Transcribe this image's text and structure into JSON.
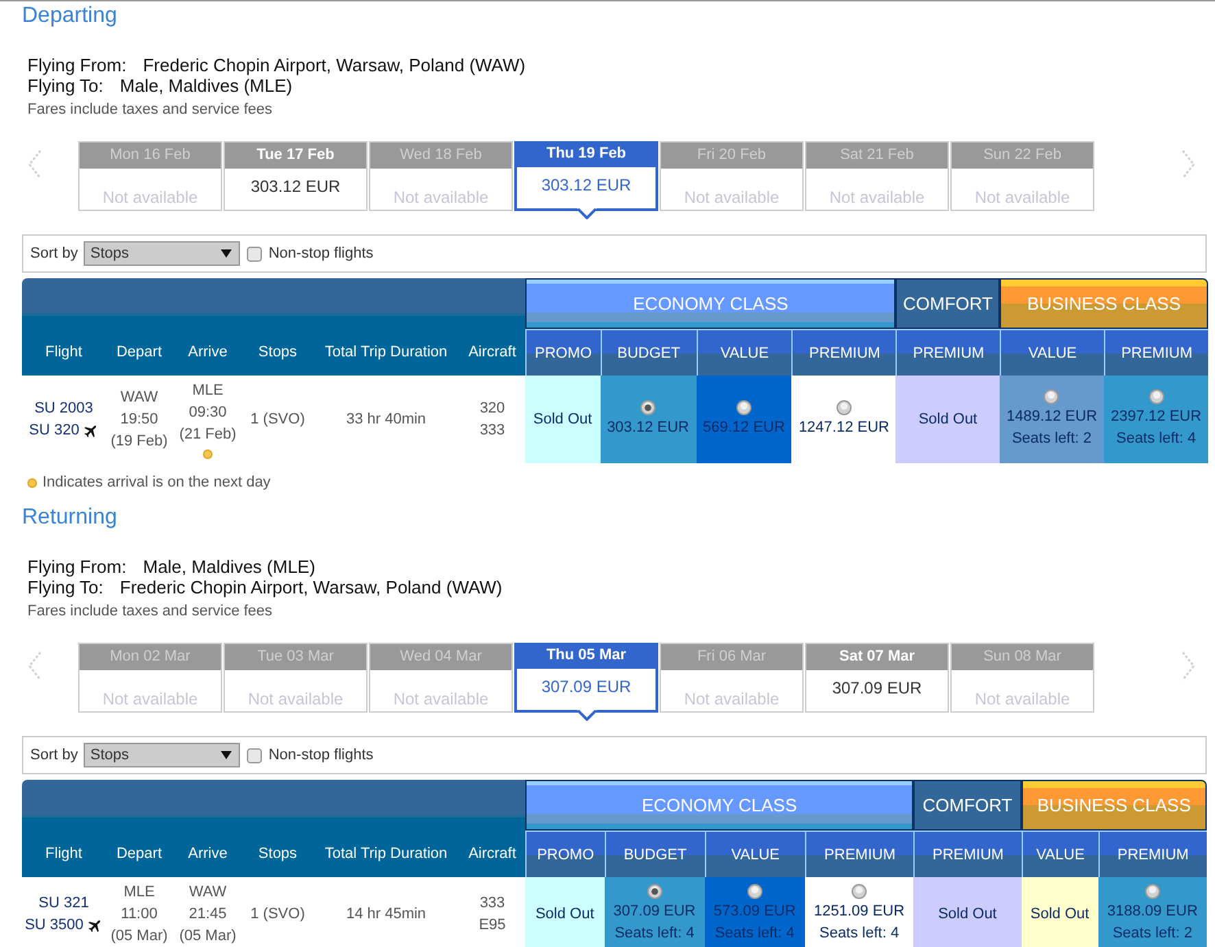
{
  "sections": [
    {
      "heading": "Departing",
      "route": [
        {
          "label": "Flying From:",
          "value": "Frederic Chopin Airport, Warsaw, Poland (WAW)"
        },
        {
          "label": "Flying To:",
          "value": "Male, Maldives (MLE)"
        }
      ],
      "fares_note": "Fares include taxes and service fees",
      "dates": [
        {
          "day": "Mon 16 Feb",
          "price": "Not available",
          "available": false,
          "selected": false
        },
        {
          "day": "Tue 17 Feb",
          "price": "303.12 EUR",
          "available": true,
          "selected": false
        },
        {
          "day": "Wed 18 Feb",
          "price": "Not available",
          "available": false,
          "selected": false
        },
        {
          "day": "Thu 19 Feb",
          "price": "303.12 EUR",
          "available": true,
          "selected": true
        },
        {
          "day": "Fri 20 Feb",
          "price": "Not available",
          "available": false,
          "selected": false
        },
        {
          "day": "Sat 21 Feb",
          "price": "Not available",
          "available": false,
          "selected": false
        },
        {
          "day": "Sun 22 Feb",
          "price": "Not available",
          "available": false,
          "selected": false
        }
      ],
      "sort": {
        "label": "Sort by",
        "value": "Stops",
        "nonstop_label": "Non-stop flights",
        "nonstop_checked": false
      },
      "columns": [
        "Flight",
        "Depart",
        "Arrive",
        "Stops",
        "Total Trip Duration",
        "Aircraft"
      ],
      "classes": [
        {
          "name": "ECONOMY CLASS",
          "kind": "economy",
          "fare_types": [
            "PROMO",
            "BUDGET",
            "VALUE",
            "PREMIUM"
          ]
        },
        {
          "name": "COMFORT",
          "kind": "comfort",
          "fare_types": [
            "PREMIUM"
          ]
        },
        {
          "name": "BUSINESS CLASS",
          "kind": "business",
          "fare_types": [
            "VALUE",
            "PREMIUM"
          ]
        }
      ],
      "flights": [
        {
          "numbers": [
            "SU 2003",
            "SU 320"
          ],
          "depart": {
            "airport": "WAW",
            "time": "19:50",
            "date": "(19 Feb)"
          },
          "arrive": {
            "airport": "MLE",
            "time": "09:30",
            "date": "(21 Feb)",
            "next_day": true
          },
          "stops": "1 (SVO)",
          "duration": "33 hr 40min",
          "aircraft": [
            "320",
            "333"
          ],
          "fares": [
            {
              "kind": "sold_out",
              "text": "Sold Out",
              "color": "#ccffff"
            },
            {
              "kind": "price",
              "price": "303.12 EUR",
              "selected": true,
              "color": "#3399cc"
            },
            {
              "kind": "price",
              "price": "569.12 EUR",
              "selected": false,
              "color": "#0066cc"
            },
            {
              "kind": "price",
              "price": "1247.12 EUR",
              "selected": false,
              "color": "#ffffff"
            },
            {
              "kind": "sold_out",
              "text": "Sold Out",
              "color": "#ccccff"
            },
            {
              "kind": "price",
              "price": "1489.12 EUR",
              "seats": "Seats left: 2",
              "selected": false,
              "color": "#6699cc"
            },
            {
              "kind": "price",
              "price": "2397.12 EUR",
              "seats": "Seats left: 4",
              "selected": false,
              "color": "#3399cc"
            }
          ]
        }
      ],
      "legend": "Indicates arrival is on the next day"
    },
    {
      "heading": "Returning",
      "route": [
        {
          "label": "Flying From:",
          "value": "Male, Maldives (MLE)"
        },
        {
          "label": "Flying To:",
          "value": "Frederic Chopin Airport, Warsaw, Poland (WAW)"
        }
      ],
      "fares_note": "Fares include taxes and service fees",
      "dates": [
        {
          "day": "Mon 02 Mar",
          "price": "Not available",
          "available": false,
          "selected": false
        },
        {
          "day": "Tue 03 Mar",
          "price": "Not available",
          "available": false,
          "selected": false
        },
        {
          "day": "Wed 04 Mar",
          "price": "Not available",
          "available": false,
          "selected": false
        },
        {
          "day": "Thu 05 Mar",
          "price": "307.09 EUR",
          "available": true,
          "selected": true
        },
        {
          "day": "Fri 06 Mar",
          "price": "Not available",
          "available": false,
          "selected": false
        },
        {
          "day": "Sat 07 Mar",
          "price": "307.09 EUR",
          "available": true,
          "selected": false
        },
        {
          "day": "Sun 08 Mar",
          "price": "Not available",
          "available": false,
          "selected": false
        }
      ],
      "sort": {
        "label": "Sort by",
        "value": "Stops",
        "nonstop_label": "Non-stop flights",
        "nonstop_checked": false
      },
      "columns": [
        "Flight",
        "Depart",
        "Arrive",
        "Stops",
        "Total Trip Duration",
        "Aircraft"
      ],
      "classes": [
        {
          "name": "ECONOMY CLASS",
          "kind": "economy",
          "fare_types": [
            "PROMO",
            "BUDGET",
            "VALUE",
            "PREMIUM"
          ]
        },
        {
          "name": "COMFORT",
          "kind": "comfort",
          "fare_types": [
            "PREMIUM"
          ]
        },
        {
          "name": "BUSINESS CLASS",
          "kind": "business",
          "fare_types": [
            "VALUE",
            "PREMIUM"
          ]
        }
      ],
      "flights": [
        {
          "numbers": [
            "SU 321",
            "SU 3500"
          ],
          "depart": {
            "airport": "MLE",
            "time": "11:00",
            "date": "(05 Mar)"
          },
          "arrive": {
            "airport": "WAW",
            "time": "21:45",
            "date": "(05 Mar)",
            "next_day": false
          },
          "stops": "1 (SVO)",
          "duration": "14 hr 45min",
          "aircraft": [
            "333",
            "E95"
          ],
          "fares": [
            {
              "kind": "sold_out",
              "text": "Sold Out",
              "color": "#ccffff"
            },
            {
              "kind": "price",
              "price": "307.09 EUR",
              "seats": "Seats left: 4",
              "selected": true,
              "color": "#3399cc"
            },
            {
              "kind": "price",
              "price": "573.09 EUR",
              "seats": "Seats left: 4",
              "selected": false,
              "color": "#0066cc"
            },
            {
              "kind": "price",
              "price": "1251.09 EUR",
              "seats": "Seats left: 4",
              "selected": false,
              "color": "#ffffff"
            },
            {
              "kind": "sold_out",
              "text": "Sold Out",
              "color": "#ccccff"
            },
            {
              "kind": "sold_out",
              "text": "Sold Out",
              "color": "#ffffcc"
            },
            {
              "kind": "price",
              "price": "3188.09 EUR",
              "seats": "Seats left: 2",
              "selected": false,
              "color": "#3399cc"
            }
          ]
        }
      ]
    }
  ]
}
